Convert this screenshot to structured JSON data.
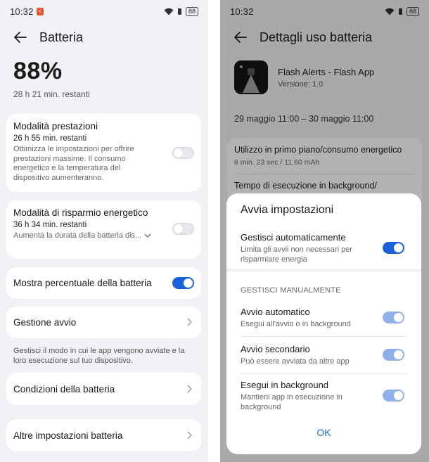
{
  "left": {
    "status": {
      "time": "10:32",
      "battery": "88"
    },
    "title": "Batteria",
    "percent": "88%",
    "remaining": "28 h 21 min. restanti",
    "performance": {
      "title": "Modalità prestazioni",
      "sub": "26 h 55 min. restanti",
      "desc": "Ottimizza le impostazioni per offrire prestazioni massime. Il consumo energetico e la temperatura del dispositivo aumenteranno."
    },
    "saving": {
      "title": "Modalità di risparmio energetico",
      "sub": "36 h 34 min. restanti",
      "desc": "Aumenta la durata della batteria dis..."
    },
    "show_pct": {
      "title": "Mostra percentuale della batteria"
    },
    "startup": {
      "title": "Gestione avvio"
    },
    "startup_note": "Gestisci il modo in cui le app vengono avviate e la loro esecuzione sul tuo dispositivo.",
    "condition": {
      "title": "Condizioni della batteria"
    },
    "more": {
      "title": "Altre impostazioni batteria"
    }
  },
  "right": {
    "status": {
      "time": "10:32",
      "battery": "88"
    },
    "title": "Dettagli uso batteria",
    "app_name": "Flash Alerts - Flash App",
    "app_version": "Versione: 1.0",
    "range": "29 maggio 11:00 – 30 maggio 11:00",
    "usage_title": "Utilizzo in primo piano/consumo energetico",
    "usage_value": "6 min. 23 sec / 11,60 mAh",
    "bg_title": "Tempo di esecuzione in background/",
    "sheet": {
      "title": "Avvia impostazioni",
      "auto_title": "Gestisci automaticamente",
      "auto_desc": "Limita gli avvii non necessari per risparmiare energia",
      "manual_section": "GESTISCI MANUALMENTE",
      "autostart_title": "Avvio automatico",
      "autostart_desc": "Esegui all'avvio o in background",
      "secondary_title": "Avvio secondario",
      "secondary_desc": "Può essere avviata da altre app",
      "background_title": "Esegui in background",
      "background_desc": "Mantieni app in esecuzione in background",
      "ok": "OK"
    }
  },
  "colors": {
    "accent": "#1a62db",
    "accent_light": "#8fb0eb",
    "bg": "#f1f2f5"
  }
}
